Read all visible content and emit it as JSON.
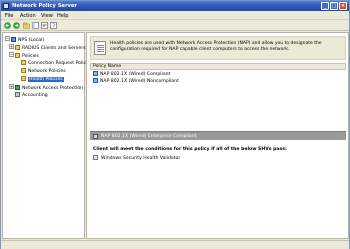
{
  "window": {
    "title": "Network Policy Server"
  },
  "menu": {
    "file": "File",
    "action": "Action",
    "view": "View",
    "help": "Help"
  },
  "tree": {
    "items": [
      {
        "label": "NPS (Local)",
        "expander": "−"
      },
      {
        "label": "RADIUS Clients and Servers",
        "expander": "+"
      },
      {
        "label": "Policies",
        "expander": "−"
      },
      {
        "label": "Connection Request Polici"
      },
      {
        "label": "Network Policies"
      },
      {
        "label": "Health Policies"
      },
      {
        "label": "Network Access Protection",
        "expander": "+"
      },
      {
        "label": "Accounting"
      }
    ]
  },
  "info": {
    "text": "Health policies are used with Network Access Protection (NAP) and allow you to designate the configuration required for NAP capable client computers to access the network."
  },
  "list": {
    "header": "Policy Name",
    "rows": [
      {
        "label": "NAP 802.1X (Wired) Compliant"
      },
      {
        "label": "NAP 802.1X (Wired) Noncompliant"
      }
    ]
  },
  "detail": {
    "title": "NAP 802.1X (Wired) Enterprise Compliant",
    "condition": "Client will meet the conditions for this policy if all of the below SHVs pass:",
    "item": "Windows Security Health Validator"
  },
  "colors": {
    "selection": "#316ac5",
    "titlebar": "#2f58b8",
    "detail_bar": "#9a9a9a"
  }
}
